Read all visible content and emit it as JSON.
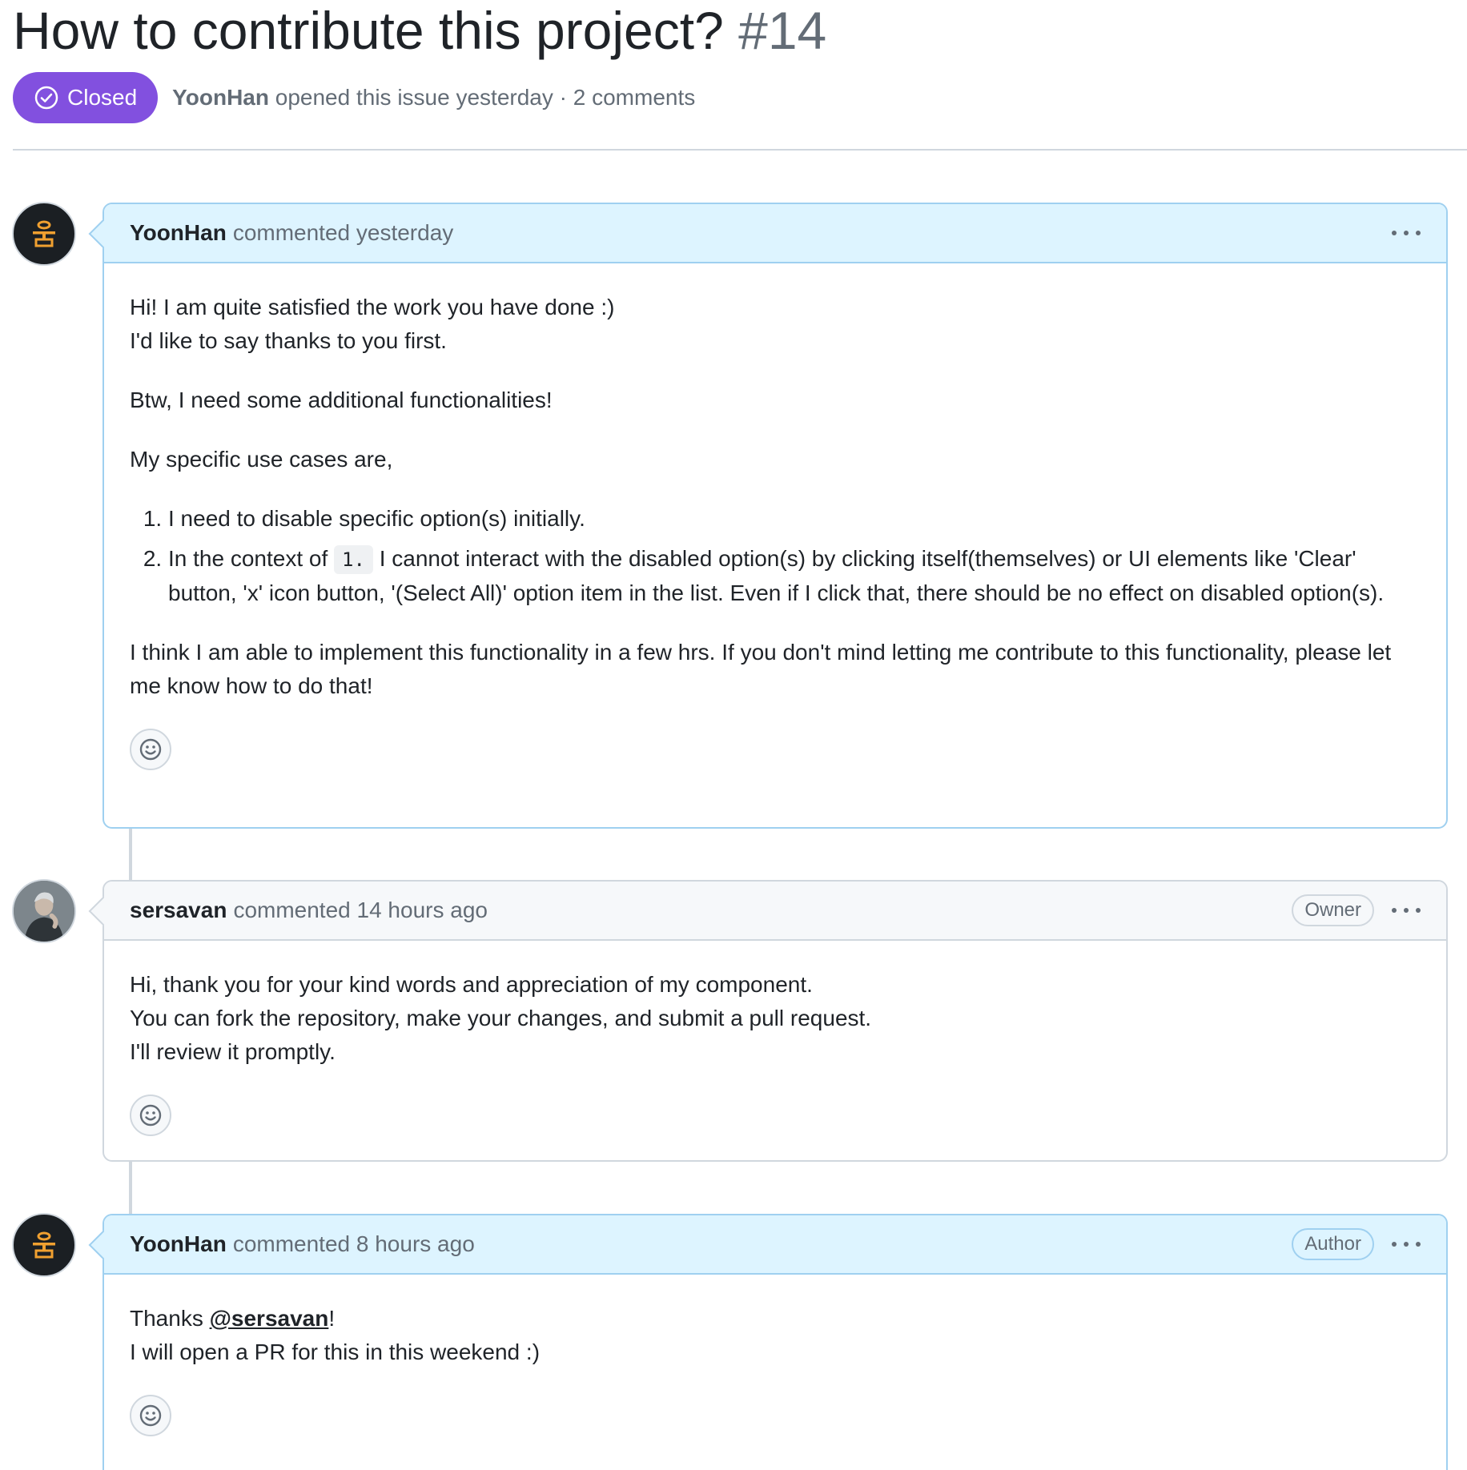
{
  "issue": {
    "title": "How to contribute this project?",
    "number": "#14",
    "state": "Closed",
    "opened_by": "YoonHan",
    "opened_text": "opened this issue yesterday · 2 comments"
  },
  "colors": {
    "closed_badge": "#8250df",
    "highlight_header": "#ddf4ff",
    "highlight_border": "#9fd0f0"
  },
  "comments": [
    {
      "author": "YoonHan",
      "time": "commented yesterday",
      "role": "",
      "lines": {
        "p1a": "Hi! I am quite satisfied the work you have done :)",
        "p1b": "I'd like to say thanks to you first.",
        "p2": "Btw, I need some additional functionalities!",
        "p3": "My specific use cases are,",
        "li1": "I need to disable specific option(s) initially.",
        "li2_pre": "In the context of ",
        "li2_code": "1.",
        "li2_post": " I cannot interact with the disabled option(s) by clicking itself(themselves) or UI elements like 'Clear' button, 'x' icon button, '(Select All)' option item in the list. Even if I click that, there should be no effect on disabled option(s).",
        "p4": "I think I am able to implement this functionality in a few hrs. If you don't mind letting me contribute to this functionality, please let me know how to do that!"
      }
    },
    {
      "author": "sersavan",
      "time": "commented 14 hours ago",
      "role": "Owner",
      "lines": {
        "l1": "Hi, thank you for your kind words and appreciation of my component.",
        "l2": "You can fork the repository, make your changes, and submit a pull request.",
        "l3": "I'll review it promptly."
      }
    },
    {
      "author": "YoonHan",
      "time": "commented 8 hours ago",
      "role": "Author",
      "lines": {
        "l1_pre": "Thanks ",
        "l1_mention": "@sersavan",
        "l1_post": "!",
        "l2": "I will open a PR for this in this weekend :)"
      }
    }
  ],
  "icons": {
    "state": "check-circle-icon",
    "reaction": "smiley-icon",
    "more": "kebab-horizontal-icon"
  }
}
